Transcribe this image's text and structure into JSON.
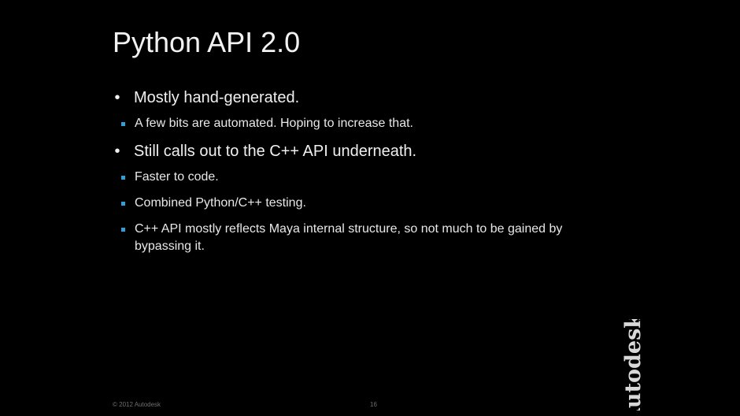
{
  "slide": {
    "title": "Python API 2.0",
    "bullet_symbol": "•",
    "bullets": [
      {
        "text": "Mostly hand-generated.",
        "subs": [
          "A few bits are automated. Hoping to increase that."
        ]
      },
      {
        "text": "Still calls out to the C++ API underneath.",
        "subs": [
          "Faster to code.",
          "Combined Python/C++ testing.",
          "C++ API mostly reflects Maya internal structure, so not much to be gained by bypassing it."
        ]
      }
    ],
    "footer": {
      "copyright": "© 2012 Autodesk",
      "page_number": "16"
    },
    "logo": {
      "text": "Autodesk",
      "registered": "®"
    }
  },
  "colors": {
    "background": "#000000",
    "text": "#f0f0f0",
    "sub_bullet_accent": "#2fa0d6",
    "footer_text": "#6f6f6f"
  }
}
